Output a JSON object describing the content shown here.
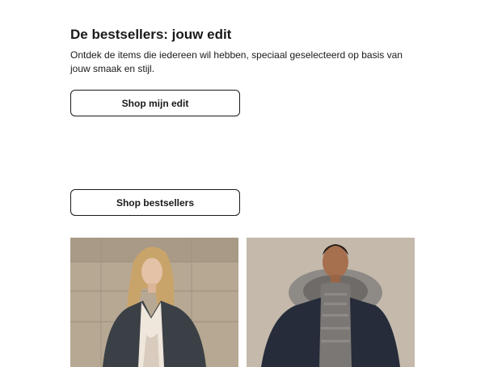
{
  "edit": {
    "title": "De bestsellers: jouw edit",
    "description": "Ontdek de items die iedereen wil hebben, speciaal geselecteerd op basis van jouw smaak en stijl.",
    "button_label": "Shop mijn edit"
  },
  "bestsellers": {
    "button_label": "Shop bestsellers"
  },
  "products": [
    {
      "image": "woman-in-dark-wool-coat"
    },
    {
      "image": "man-in-navy-parka-with-fur-hood"
    }
  ],
  "colors": {
    "text": "#1a1a1a",
    "button_border": "#1a1a1a",
    "background": "#ffffff"
  }
}
